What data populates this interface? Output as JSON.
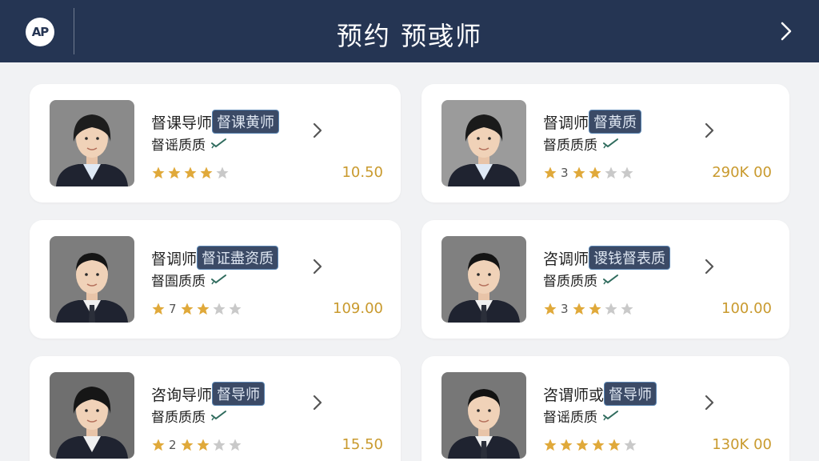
{
  "header": {
    "logo_text": "AP",
    "title": "预约 预彧师"
  },
  "colors": {
    "header_bg": "#253553",
    "price": "#c99a2e",
    "star_filled": "#e0a93a",
    "star_empty": "#c9c9c9",
    "tag_bg": "#3b4a66"
  },
  "cards": [
    {
      "name": "督课导师",
      "tag": "督课黄师",
      "sub": "督谣质质",
      "rating_num": "",
      "filled_stars": 4,
      "total_stars": 5,
      "price": "10.50"
    },
    {
      "name": "督调师",
      "tag": "督黄质",
      "sub": "督质质质",
      "rating_num": "3",
      "filled_stars": 3,
      "total_stars": 5,
      "price": "290K 00"
    },
    {
      "name": "督调师",
      "tag": "督证盡资质",
      "sub": "督圄质质",
      "rating_num": "7",
      "filled_stars": 3,
      "total_stars": 5,
      "price": "109.00"
    },
    {
      "name": "咨调师",
      "tag": "谡钱督表质",
      "sub": "督质质质",
      "rating_num": "3",
      "filled_stars": 3,
      "total_stars": 5,
      "price": "100.00"
    },
    {
      "name": "咨询导师",
      "tag": "督导师",
      "sub": "督质质质",
      "rating_num": "2",
      "filled_stars": 3,
      "total_stars": 5,
      "price": "15.50"
    },
    {
      "name": "咨谓师或",
      "tag": "督导师",
      "sub": "督谣质质",
      "rating_num": "",
      "filled_stars": 5,
      "total_stars": 6,
      "price": "130K 00"
    }
  ]
}
